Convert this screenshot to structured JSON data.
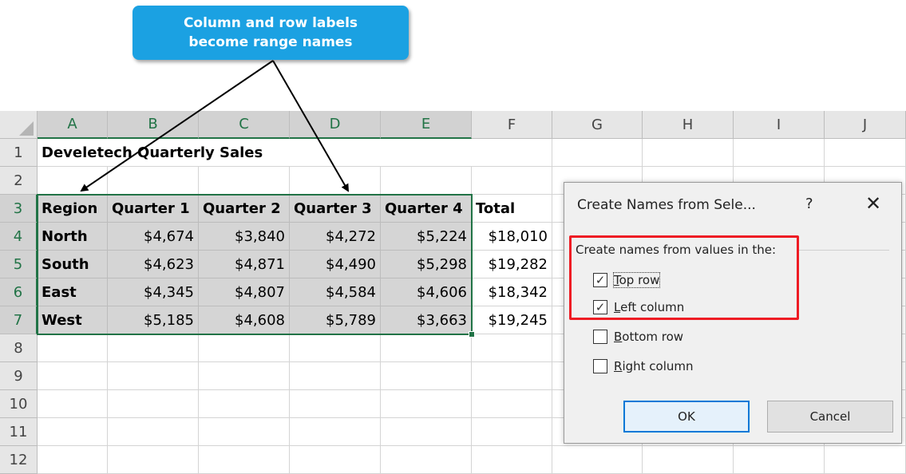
{
  "callout": {
    "line1": "Column and row labels",
    "line2": "become range names"
  },
  "sheet": {
    "columns": [
      "A",
      "B",
      "C",
      "D",
      "E",
      "F",
      "G",
      "H",
      "I",
      "J"
    ],
    "rows": [
      "1",
      "2",
      "3",
      "4",
      "5",
      "6",
      "7",
      "8",
      "9",
      "10",
      "11",
      "12"
    ],
    "title": "Develetech Quarterly Sales",
    "headers": [
      "Region",
      "Quarter 1",
      "Quarter 2",
      "Quarter 3",
      "Quarter 4",
      "Total"
    ],
    "data": [
      [
        "North",
        "$4,674",
        "$3,840",
        "$4,272",
        "$5,224",
        "$18,010"
      ],
      [
        "South",
        "$4,623",
        "$4,871",
        "$4,490",
        "$5,298",
        "$19,282"
      ],
      [
        "East",
        "$4,345",
        "$4,807",
        "$4,584",
        "$4,606",
        "$18,342"
      ],
      [
        "West",
        "$5,185",
        "$4,608",
        "$5,789",
        "$3,663",
        "$19,245"
      ]
    ]
  },
  "dialog": {
    "title": "Create Names from Sele...",
    "help": "?",
    "close": "✕",
    "group_label": "Create names from values in the:",
    "options": [
      {
        "label": "Top row",
        "checked": true
      },
      {
        "label": "Left column",
        "checked": true
      },
      {
        "label": "Bottom row",
        "checked": false
      },
      {
        "label": "Right column",
        "checked": false
      }
    ],
    "ok_label": "OK",
    "cancel_label": "Cancel"
  },
  "colors": {
    "accent": "#217346",
    "callout": "#1ba1e2",
    "highlight": "#ee1c24",
    "ok_border": "#0078d7"
  }
}
